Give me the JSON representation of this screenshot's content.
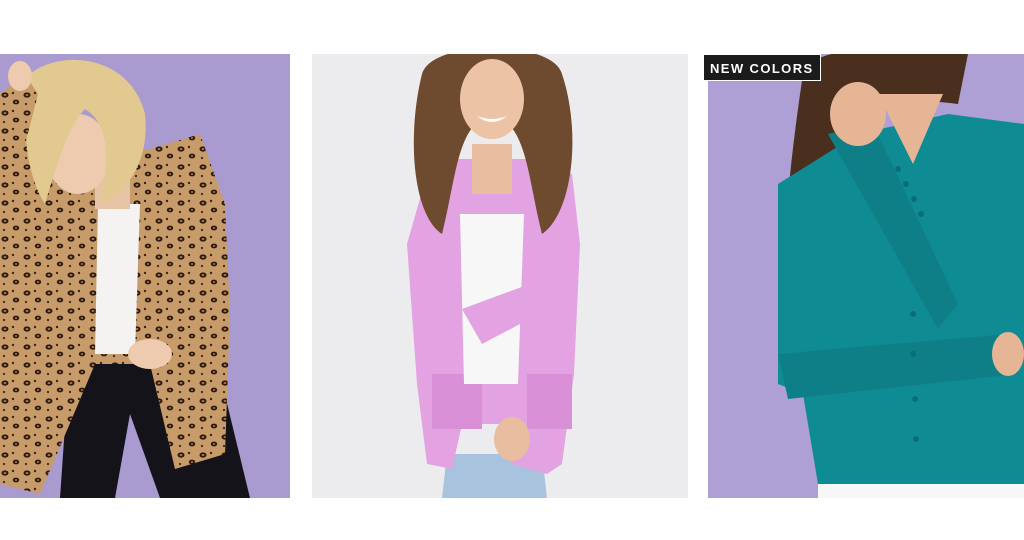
{
  "products": [
    {
      "image": "leopard-print-cardigan-photo",
      "background": "#a99bd0",
      "garment_color": "#c79b6a",
      "badge": ""
    },
    {
      "image": "pink-cardigan-photo",
      "background": "#ececee",
      "garment_color": "#e3a2e2",
      "badge": ""
    },
    {
      "image": "teal-cardigan-photo",
      "background": "#ae9fd4",
      "garment_color": "#0f8b93",
      "badge": "NEW COLORS"
    }
  ]
}
